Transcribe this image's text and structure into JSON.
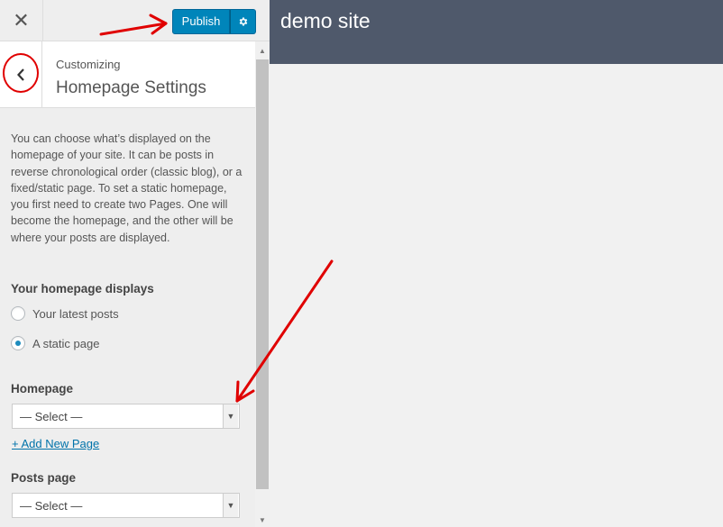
{
  "topbar": {
    "close_icon": "close-icon",
    "publish_label": "Publish",
    "settings_icon": "gear-icon"
  },
  "section": {
    "back_icon": "chevron-left-icon",
    "customizing": "Customizing",
    "title": "Homepage Settings"
  },
  "content": {
    "description": "You can choose what’s displayed on the homepage of your site. It can be posts in reverse chronological order (classic blog), or a fixed/static page. To set a static homepage, you first need to create two Pages. One will become the homepage, and the other will be where your posts are displayed.",
    "homepage_displays_label": "Your homepage displays",
    "options": [
      {
        "label": "Your latest posts",
        "checked": false
      },
      {
        "label": "A static page",
        "checked": true
      }
    ],
    "homepage_label": "Homepage",
    "homepage_select": "— Select —",
    "add_new_page": "+ Add New Page",
    "posts_page_label": "Posts page",
    "posts_page_select": "— Select —"
  },
  "preview": {
    "site_title": "demo site"
  },
  "colors": {
    "accent": "#0085ba",
    "header": "#4f596b",
    "annotation": "#e00000"
  }
}
